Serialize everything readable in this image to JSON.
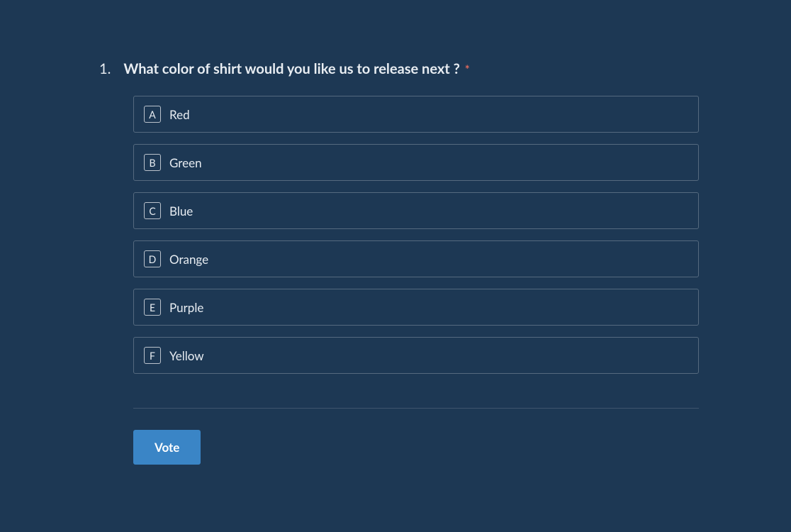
{
  "question": {
    "number": "1.",
    "text": "What color of shirt would you like us to release next ?",
    "required": true,
    "required_mark": "*"
  },
  "options": [
    {
      "key": "A",
      "label": "Red"
    },
    {
      "key": "B",
      "label": "Green"
    },
    {
      "key": "C",
      "label": "Blue"
    },
    {
      "key": "D",
      "label": "Orange"
    },
    {
      "key": "E",
      "label": "Purple"
    },
    {
      "key": "F",
      "label": "Yellow"
    }
  ],
  "actions": {
    "vote_label": "Vote"
  },
  "colors": {
    "background": "#1d3854",
    "text": "#e8edf2",
    "required": "#e16a5d",
    "button": "#3a85c6"
  }
}
